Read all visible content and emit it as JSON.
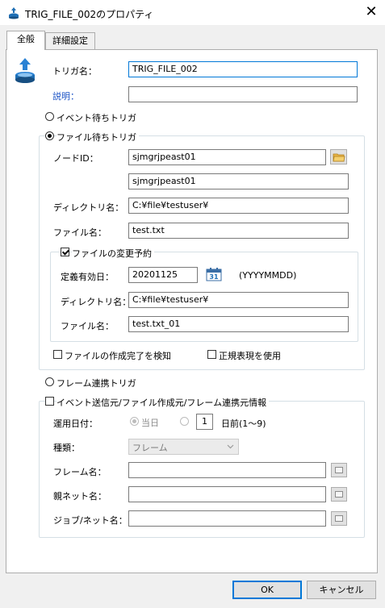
{
  "window": {
    "title": "TRIG_FILE_002のプロパティ"
  },
  "tabs": [
    "全般",
    "詳細設定"
  ],
  "trigger_name": {
    "label": "トリガ名：",
    "value": "TRIG_FILE_002"
  },
  "description": {
    "label": "説明：",
    "value": ""
  },
  "trigger_type": {
    "event_wait": "イベント待ちトリガ",
    "file_wait": "ファイル待ちトリガ",
    "frame_link": "フレーム連携トリガ"
  },
  "file_trigger": {
    "node_id_label": "ノードID：",
    "node_id_1": "sjmgrjpeast01",
    "node_id_2": "sjmgrjpeast01",
    "dir_label": "ディレクトリ名：",
    "dir_value": "C:¥file¥testuser¥",
    "file_label": "ファイル名：",
    "file_value": "test.txt",
    "change_group": {
      "label": "ファイルの変更予約",
      "date_label": "定義有効日：",
      "date_value": "20201125",
      "date_format": "(YYYYMMDD)",
      "dir_label": "ディレクトリ名：",
      "dir_value": "C:¥file¥testuser¥",
      "file_label": "ファイル名：",
      "file_value": "test.txt_01"
    },
    "detect_complete": "ファイルの作成完了を検知",
    "use_regex": "正規表現を使用"
  },
  "source_info": {
    "label": "イベント送信元/ファイル作成元/フレーム連携元情報",
    "op_date_label": "運用日付：",
    "today": "当日",
    "days_value": "1",
    "days_before": "日前(1〜9)",
    "kind_label": "種類：",
    "kind_value": "フレーム",
    "frame_label": "フレーム名：",
    "parent_net_label": "親ネット名：",
    "job_net_label": "ジョブ/ネット名："
  },
  "buttons": {
    "ok": "OK",
    "cancel": "キャンセル"
  }
}
